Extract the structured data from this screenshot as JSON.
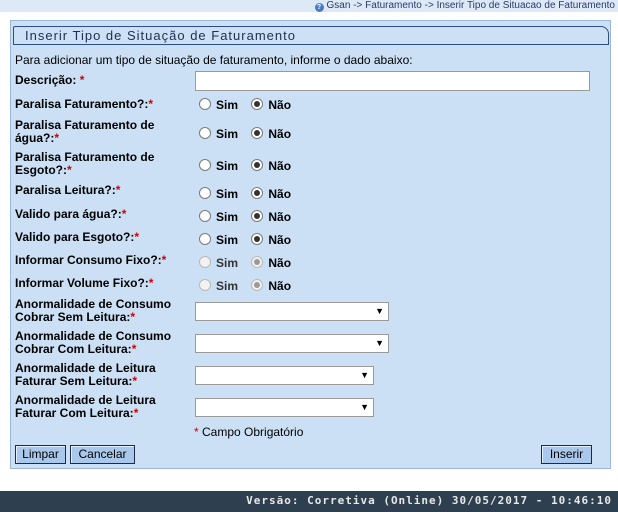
{
  "breadcrumb": "Gsan -> Faturamento -> Inserir Tipo de Situacao de Faturamento",
  "title": "Inserir Tipo de Situação de Faturamento",
  "intro": "Para adicionar um tipo de situação de faturamento, informe o dado abaixo:",
  "descricao": {
    "label": "Descrição:",
    "required": "*",
    "value": ""
  },
  "radios": {
    "yes": "Sim",
    "no": "Não",
    "items": [
      {
        "label": "Paralisa Faturamento?:",
        "required": "*",
        "selected": "Não",
        "enabled": true
      },
      {
        "label": "Paralisa Faturamento de água?:",
        "required": "*",
        "selected": "Não",
        "enabled": true
      },
      {
        "label": "Paralisa Faturamento de Esgoto?:",
        "required": "*",
        "selected": "Não",
        "enabled": true
      },
      {
        "label": "Paralisa Leitura?:",
        "required": "*",
        "selected": "Não",
        "enabled": true
      },
      {
        "label": "Valido para água?:",
        "required": "*",
        "selected": "Não",
        "enabled": true
      },
      {
        "label": "Valido para Esgoto?:",
        "required": "*",
        "selected": "Não",
        "enabled": true
      },
      {
        "label": "Informar Consumo Fixo?:",
        "required": "*",
        "selected": "Não",
        "enabled": false
      },
      {
        "label": "Informar Volume Fixo?:",
        "required": "*",
        "selected": "Não",
        "enabled": false
      }
    ]
  },
  "selects": [
    {
      "label": "Anormalidade de Consumo Cobrar Sem Leitura:",
      "required": "*",
      "value": ""
    },
    {
      "label": "Anormalidade de Consumo Cobrar Com Leitura:",
      "required": "*",
      "value": ""
    },
    {
      "label": "Anormalidade de Leitura Faturar Sem Leitura:",
      "required": "*",
      "value": ""
    },
    {
      "label": "Anormalidade de Leitura Faturar Com Leitura:",
      "required": "*",
      "value": ""
    }
  ],
  "required_note": {
    "star": "*",
    "text": "Campo Obrigatório"
  },
  "buttons": {
    "clear": "Limpar",
    "cancel": "Cancelar",
    "insert": "Inserir"
  },
  "version": "Versão: Corretiva (Online) 30/05/2017 - 10:46:10"
}
